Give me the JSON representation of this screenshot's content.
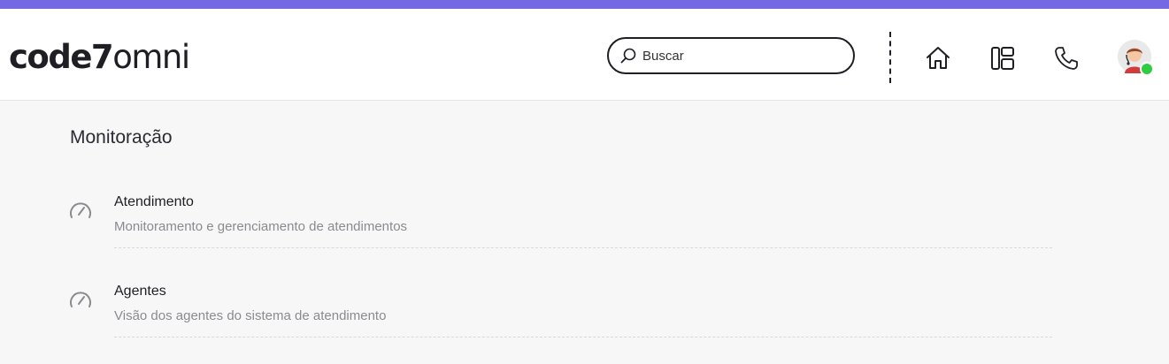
{
  "header": {
    "logo_bold": "code7",
    "logo_light": "omni",
    "search": {
      "placeholder": "Buscar",
      "value": ""
    },
    "icons": [
      "home-icon",
      "dashboard-icon",
      "phone-icon"
    ],
    "user": {
      "status": "online",
      "status_color": "#2ecc40"
    },
    "accent_color": "#7468e3"
  },
  "main": {
    "title": "Monitoração",
    "items": [
      {
        "title": "Atendimento",
        "description": "Monitoramento e gerenciamento de atendimentos",
        "icon": "speedometer-icon"
      },
      {
        "title": "Agentes",
        "description": "Visão dos agentes do sistema de atendimento",
        "icon": "speedometer-icon"
      }
    ]
  }
}
